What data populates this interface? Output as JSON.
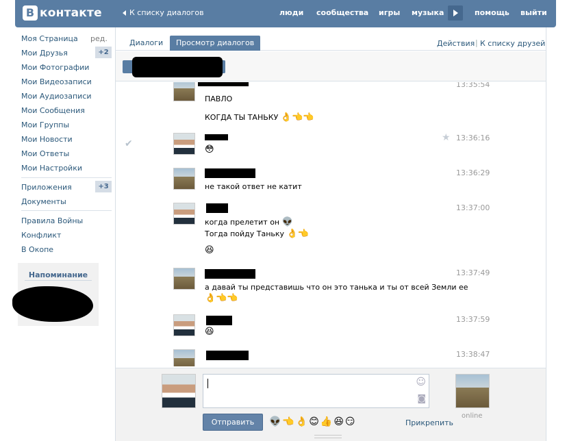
{
  "topbar": {
    "logo_letter": "В",
    "logo_text": "контакте",
    "back_link": "К списку диалогов",
    "nav": [
      "люди",
      "сообщества",
      "игры",
      "музыка",
      "помощь",
      "выйти"
    ]
  },
  "sidebar": {
    "items_top": [
      "Моя Страница",
      "Мои Друзья",
      "Мои Фотографии",
      "Мои Видеозаписи",
      "Мои Аудиозаписи",
      "Мои Сообщения",
      "Мои Группы",
      "Мои Новости",
      "Мои Ответы",
      "Мои Настройки"
    ],
    "edit_label": "ред.",
    "friends_badge": "+2",
    "items_mid": [
      "Приложения",
      "Документы"
    ],
    "apps_badge": "+3",
    "items_bottom": [
      "Правила Войны",
      "Конфликт",
      "В Окопе"
    ],
    "reminder_title": "Напоминание"
  },
  "tabs": {
    "dialogs": "Диалоги",
    "view": "Просмотр диалогов",
    "actions": "Действия",
    "separator": "|",
    "friends_list": "К списку друзей"
  },
  "messages": [
    {
      "time": "13:35:54",
      "lines": [
        "ПАВЛО",
        "КОГДА ТЫ ТАНЬКУ"
      ],
      "emoji": "👌👈👈"
    },
    {
      "time": "13:36:16",
      "lines": [],
      "emoji": "😳"
    },
    {
      "time": "13:36:29",
      "lines": [
        "не такой ответ не катит"
      ],
      "emoji": ""
    },
    {
      "time": "13:37:00",
      "lines": [
        "когда прелетит он",
        "Тогда пойду Таньку"
      ],
      "emoji": "👽👌👈😆"
    },
    {
      "time": "13:37:49",
      "lines": [
        "а давай ты представишь что он это танька и ты от всей Земли ее"
      ],
      "emoji": "👌👈👈"
    },
    {
      "time": "13:37:59",
      "lines": [],
      "emoji": "😆"
    },
    {
      "time": "13:38:47",
      "lines": [],
      "emoji": ""
    }
  ],
  "compose": {
    "send": "Отправить",
    "attach": "Прикрепить",
    "online": "online",
    "emoji_row": "👽👈👌😊👍😆😏"
  },
  "colors": {
    "header": "#597da3",
    "link": "#2b587a",
    "badge_bg": "#d5dde6"
  }
}
